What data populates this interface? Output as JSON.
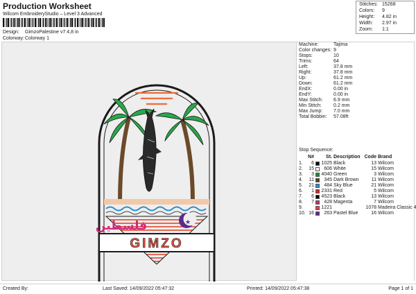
{
  "header": {
    "title": "Production Worksheet",
    "software": "Wilcom EmbroideryStudio – Level 3 Advanced",
    "design_label": "Design:",
    "design_value": "GimzoPalestine v7 4,8 in",
    "colorway_label": "Colorway:",
    "colorway_value": "Colorway 1"
  },
  "stats": [
    {
      "label": "Stitches:",
      "value": "15268"
    },
    {
      "label": "Colors:",
      "value": "9"
    },
    {
      "label": "Height:",
      "value": "4.82 in"
    },
    {
      "label": "Width:",
      "value": "2.97 in"
    },
    {
      "label": "Zoom:",
      "value": "1:1"
    }
  ],
  "design": {
    "brand_text": "GIMZO",
    "arabic_text": "فلسطين"
  },
  "machine_info": [
    {
      "label": "Machine:",
      "value": "Tajima"
    },
    {
      "label": "Color changes:",
      "value": "9"
    },
    {
      "label": "Stops:",
      "value": "10"
    },
    {
      "label": "Trims:",
      "value": "64"
    },
    {
      "label": "Left:",
      "value": "37.8 mm"
    },
    {
      "label": "Right:",
      "value": "37.8 mm"
    },
    {
      "label": "Up:",
      "value": "61.2 mm"
    },
    {
      "label": "Down:",
      "value": "61.2 mm"
    },
    {
      "label": "EndX:",
      "value": "0.00 in"
    },
    {
      "label": "EndY:",
      "value": "0.00 in"
    },
    {
      "label": "Max Stitch:",
      "value": "6.9 mm"
    },
    {
      "label": "Min Stitch:",
      "value": "0.2 mm"
    },
    {
      "label": "Max Jump:",
      "value": "7.0 mm"
    },
    {
      "label": "Total Bobbin:",
      "value": "57.08ft"
    }
  ],
  "stop_sequence": {
    "title": "Stop Sequence:",
    "headers": {
      "idx": "",
      "n": "N#",
      "st": "St.",
      "desc": "Description",
      "code": "Code",
      "brand": "Brand"
    },
    "rows": [
      {
        "idx": "1.",
        "n": "6",
        "st": "1025",
        "color": "#000000",
        "desc": "Black",
        "code": "13",
        "brand": "Wilcom"
      },
      {
        "idx": "2.",
        "n": "15",
        "st": "606",
        "color": "#ffffff",
        "desc": "White",
        "code": "15",
        "brand": "Wilcom"
      },
      {
        "idx": "3.",
        "n": "3",
        "st": "4040",
        "color": "#1e8a3c",
        "desc": "Green",
        "code": "3",
        "brand": "Wilcom"
      },
      {
        "idx": "4.",
        "n": "11",
        "st": "345",
        "color": "#5c3a1e",
        "desc": "Dark Brown",
        "code": "11",
        "brand": "Wilcom"
      },
      {
        "idx": "5.",
        "n": "21",
        "st": "484",
        "color": "#2a8fd0",
        "desc": "Sky Blue",
        "code": "21",
        "brand": "Wilcom"
      },
      {
        "idx": "6.",
        "n": "1",
        "st": "2331",
        "color": "#d62828",
        "desc": "Red",
        "code": "5",
        "brand": "Wilcom"
      },
      {
        "idx": "7.",
        "n": "6",
        "st": "4523",
        "color": "#000000",
        "desc": "Black",
        "code": "13",
        "brand": "Wilcom"
      },
      {
        "idx": "8.",
        "n": "7",
        "st": "428",
        "color": "#d1287a",
        "desc": "Magenta",
        "code": "7",
        "brand": "Wilcom"
      },
      {
        "idx": "9.",
        "n": "",
        "st": "1221",
        "color": "#e63b4a",
        "desc": "",
        "code": "1078",
        "brand": "Madeira Classic 40"
      },
      {
        "idx": "10.",
        "n": "16",
        "st": "263",
        "color": "#5b2a8c",
        "desc": "Pastel Blue",
        "code": "16",
        "brand": "Wilcom"
      }
    ]
  },
  "footer": {
    "created": "Created By:",
    "saved": "Last Saved: 14/09/2022 05:47:32",
    "printed": "Printed: 14/09/2022 05:47:38",
    "page": "Page 1 of 1"
  },
  "colors": {
    "outline": "#1a1a1a",
    "palm_green": "#2aa84a",
    "trunk_brown": "#6b4a2a",
    "stripe_red": "#e2553f",
    "wave_blue": "#2a8fd0",
    "moon_purple": "#5b2a8c",
    "arabic_magenta": "#d1287a",
    "sun_orange": "#ef6a3a"
  }
}
